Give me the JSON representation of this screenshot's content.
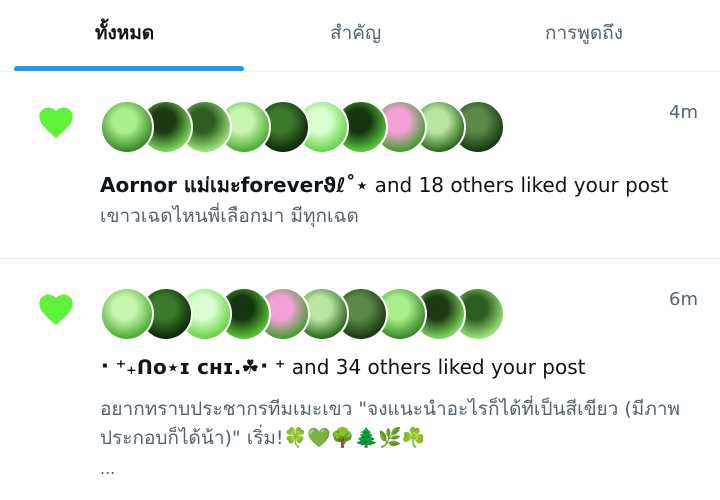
{
  "tabs": [
    {
      "label": "ทั้งหมด",
      "active": true
    },
    {
      "label": "สำคัญ",
      "active": false
    },
    {
      "label": "การพูดถึง",
      "active": false
    }
  ],
  "colors": {
    "accent": "#1d9bf0",
    "heart": "#5ff23a",
    "text_primary": "#0f1419",
    "text_secondary": "#536471"
  },
  "notifications": [
    {
      "icon": "heart-icon",
      "time": "4m",
      "user_name": "Aornor แม่เมะforeverϑℓ˚⋆",
      "rest": " and 18 others liked your post",
      "post_text": "เขาวเฉดไหนพี่เลือกมา มีทุกเฉด",
      "avatar_count": 10
    },
    {
      "icon": "heart-icon",
      "time": "6m",
      "user_name": "⠂⁺₊ᑎo⋆ɪ ᴄʜɪ.☘︎⠂⁺",
      "rest": " and 34 others liked your post",
      "post_text": "อยากทราบประชากรทีมเมะเขว \"จงแนะนำอะไรก็ได้ที่เป็นสีเขียว (มีภาพประกอบก็ได้น้า)\" เริ่ม!🍀💚🌳🌲🌿☘️",
      "ellipsis": "...",
      "avatar_count": 10
    }
  ]
}
